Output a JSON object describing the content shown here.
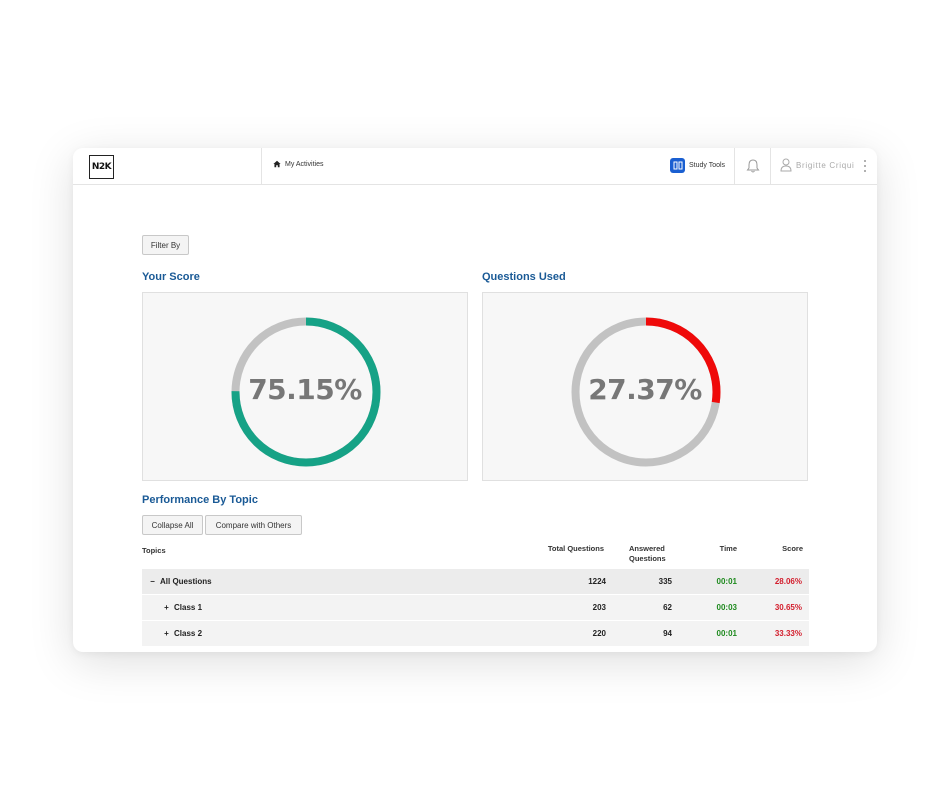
{
  "header": {
    "logo_text": "N2K",
    "nav_activities": "My Activities",
    "study_tools": "Study Tools",
    "user_name": "Brigitte Criqui"
  },
  "filter_button": "Filter By",
  "score_section": {
    "title": "Your Score",
    "value": "75.15%",
    "fraction": 0.7515,
    "color": "#16a286"
  },
  "questions_section": {
    "title": "Questions Used",
    "value": "27.37%",
    "fraction": 0.2737,
    "color": "#ef0a0a"
  },
  "performance": {
    "title": "Performance By Topic",
    "collapse_all": "Collapse All",
    "compare": "Compare with Others",
    "columns": {
      "topics": "Topics",
      "total": "Total Questions",
      "answered_line1": "Answered",
      "answered_line2": "Questions",
      "time": "Time",
      "score": "Score"
    },
    "rows": [
      {
        "toggle": "−",
        "topic": "All Questions",
        "total": "1224",
        "answered": "335",
        "time": "00:01",
        "score": "28.06%"
      },
      {
        "toggle": "+",
        "topic": "Class 1",
        "total": "203",
        "answered": "62",
        "time": "00:03",
        "score": "30.65%"
      },
      {
        "toggle": "+",
        "topic": "Class 2",
        "total": "220",
        "answered": "94",
        "time": "00:01",
        "score": "33.33%"
      }
    ]
  },
  "colors": {
    "accent": "#1a5a96",
    "ring_track": "#c2c2c2",
    "study_icon": "#1a5fd1"
  }
}
